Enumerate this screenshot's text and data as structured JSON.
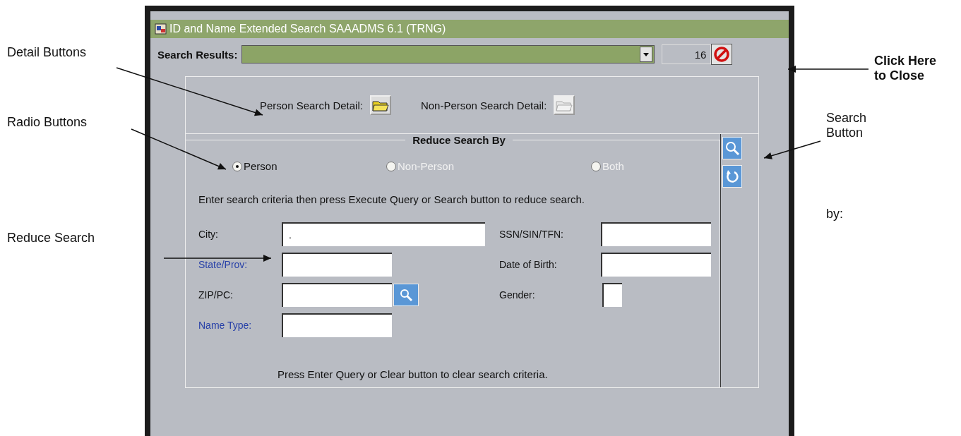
{
  "callouts_left": [
    {
      "text": "Detail Buttons"
    },
    {
      "text": "Radio Buttons"
    },
    {
      "text": "Reduce Search"
    }
  ],
  "callouts_right": [
    {
      "text": "Click Here\nto Close",
      "bold": true
    },
    {
      "text": "Search\nButton",
      "bold": false
    },
    {
      "text": "by:",
      "bold": false
    }
  ],
  "window": {
    "title": "ID and Name Extended Search  SAAADMS  6.1  (TRNG)"
  },
  "search_results": {
    "label": "Search Results:",
    "count": "16"
  },
  "detail_buttons": [
    {
      "label": "Person Search Detail:",
      "disabled": false
    },
    {
      "label": "Non-Person Search Detail:",
      "disabled": true
    }
  ],
  "reduce_search": {
    "title": "Reduce Search By",
    "radios": [
      {
        "label": "Person",
        "selected": true,
        "disabled": false
      },
      {
        "label": "Non-Person",
        "selected": false,
        "disabled": true
      },
      {
        "label": "Both",
        "selected": false,
        "disabled": true
      }
    ],
    "instruction": "Enter search criteria then press Execute Query or Search button to reduce search.",
    "left_fields": [
      {
        "label": "City:",
        "linked": false,
        "value": "."
      },
      {
        "label": "State/Prov:",
        "linked": true
      },
      {
        "label": "ZIP/PC:",
        "linked": false,
        "lookup": true
      },
      {
        "label": "Name Type:",
        "linked": true
      }
    ],
    "right_fields": [
      {
        "label": "SSN/SIN/TFN:",
        "linked": false
      },
      {
        "label": "Date of Birth:",
        "linked": false
      },
      {
        "label": "Gender:",
        "linked": false
      }
    ],
    "footer": "Press Enter Query or Clear button to clear search criteria."
  }
}
